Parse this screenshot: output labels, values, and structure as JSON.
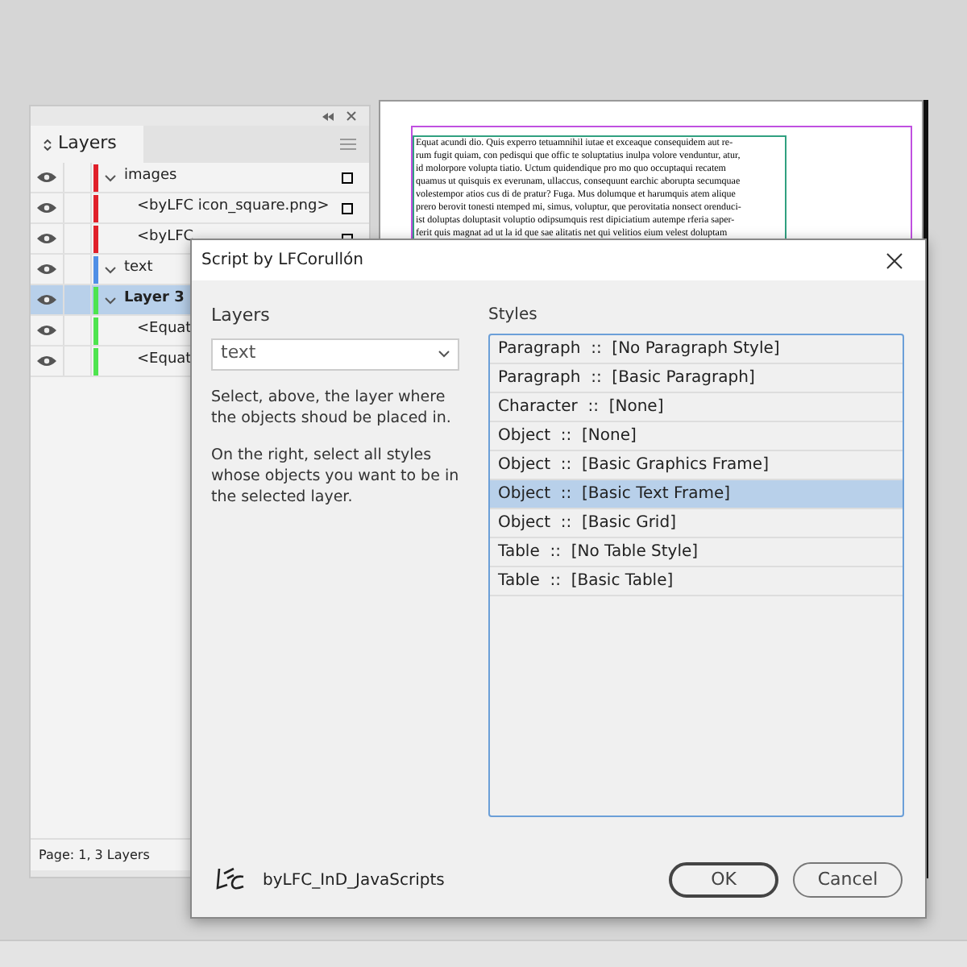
{
  "layers_panel": {
    "title": "Layers",
    "status": "Page: 1, 3 Layers",
    "rows": [
      {
        "label": "images",
        "kind": "layer",
        "color": "#e0202a",
        "selected": false,
        "expanded": true
      },
      {
        "label": "<byLFC icon_square.png>",
        "kind": "item",
        "color": "#e0202a",
        "selected": false
      },
      {
        "label": "<byLFC",
        "kind": "item",
        "color": "#e0202a",
        "selected": false
      },
      {
        "label": "text",
        "kind": "layer",
        "color": "#4f8fe6",
        "selected": false,
        "expanded": true
      },
      {
        "label": "Layer 3",
        "kind": "layer",
        "color": "#4ee44e",
        "selected": true,
        "expanded": true
      },
      {
        "label": "<Equat",
        "kind": "item",
        "color": "#4ee44e",
        "selected": false
      },
      {
        "label": "<Equat",
        "kind": "item",
        "color": "#4ee44e",
        "selected": false
      }
    ]
  },
  "document": {
    "lines": [
      "Equat acundi dio. Quis experro tetuamnihil iutae et exceaque consequidem aut re-",
      "rum fugit quiam, con pedisqui que offic te soluptatius inulpa volore venduntur, atur,",
      "id molorpore volupta tiatio. Uctum quidendique pro mo quo occuptaqui recatem",
      "quamus ut quisquis ex everunam, ullaccus, consequunt earchic aborupta secumquae",
      "volestempor atios cus di de pratur? Fuga. Mus dolumque et harumquis atem alique",
      "prero berovit tonesti ntemped mi, simus, voluptur, que perovitatia nonsect orenduci-",
      "ist doluptas doluptasit voluptio odipsumquis rest dipiciatium autempe rferia saper-",
      "ferit quis magnat ad ut la id que sae alitatis net qui velitios eium velest doluptam"
    ]
  },
  "dialog": {
    "title": "Script by LFCorullón",
    "layers_label": "Layers",
    "layer_select": {
      "value": "text"
    },
    "help": [
      "Select, above, the layer where the objects shoud be placed in.",
      "On the right, select all styles whose objects you want to be in the selected layer."
    ],
    "styles_label": "Styles",
    "styles": [
      {
        "label": "Paragraph  ::  [No Paragraph Style]",
        "selected": false
      },
      {
        "label": "Paragraph  ::  [Basic Paragraph]",
        "selected": false
      },
      {
        "label": "Character  ::  [None]",
        "selected": false
      },
      {
        "label": "Object  ::  [None]",
        "selected": false
      },
      {
        "label": "Object  ::  [Basic Graphics Frame]",
        "selected": false
      },
      {
        "label": "Object  ::  [Basic Text Frame]",
        "selected": true
      },
      {
        "label": "Object  ::  [Basic Grid]",
        "selected": false
      },
      {
        "label": "Table  ::  [No Table Style]",
        "selected": false
      },
      {
        "label": "Table  ::  [Basic Table]",
        "selected": false
      }
    ],
    "brand": "byLFC_InD_JavaScripts",
    "buttons": [
      {
        "label": "OK",
        "kind": "default"
      },
      {
        "label": "Cancel",
        "kind": "normal"
      }
    ]
  }
}
